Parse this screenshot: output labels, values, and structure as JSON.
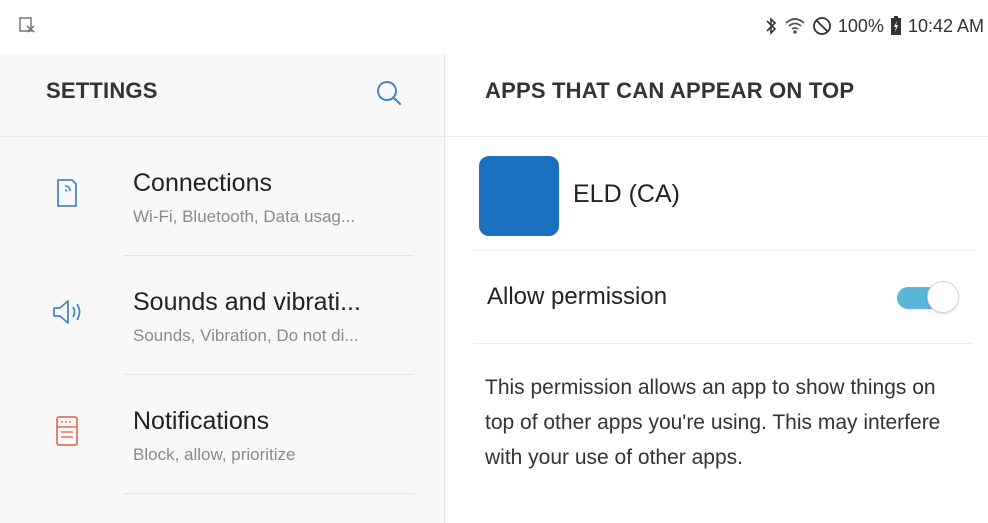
{
  "status_bar": {
    "left_icon": "screenshot-notification-icon",
    "icons": [
      "bluetooth-icon",
      "wifi-icon",
      "do-not-disturb-icon",
      "battery-icon"
    ],
    "battery": "100%",
    "time": "10:42 AM"
  },
  "left_pane": {
    "title": "SETTINGS",
    "search_icon": "search-icon",
    "items": [
      {
        "icon": "connections-icon",
        "title": "Connections",
        "subtitle": "Wi-Fi, Bluetooth, Data usag..."
      },
      {
        "icon": "sound-icon",
        "title": "Sounds and vibrati...",
        "subtitle": "Sounds, Vibration, Do not di..."
      },
      {
        "icon": "notifications-icon",
        "title": "Notifications",
        "subtitle": "Block, allow, prioritize"
      }
    ]
  },
  "right_pane": {
    "title": "APPS THAT CAN APPEAR ON TOP",
    "app": {
      "name": "ELD (CA)",
      "icon_color": "#1b6fbf"
    },
    "permission": {
      "label": "Allow permission",
      "enabled": true
    },
    "description": "This permission allows an app to show things on top of other apps you're using. This may interfere with your use of other apps."
  },
  "colors": {
    "accent": "#5ab7d8",
    "icon_blue": "#4a86c7",
    "icon_red": "#e57060"
  }
}
